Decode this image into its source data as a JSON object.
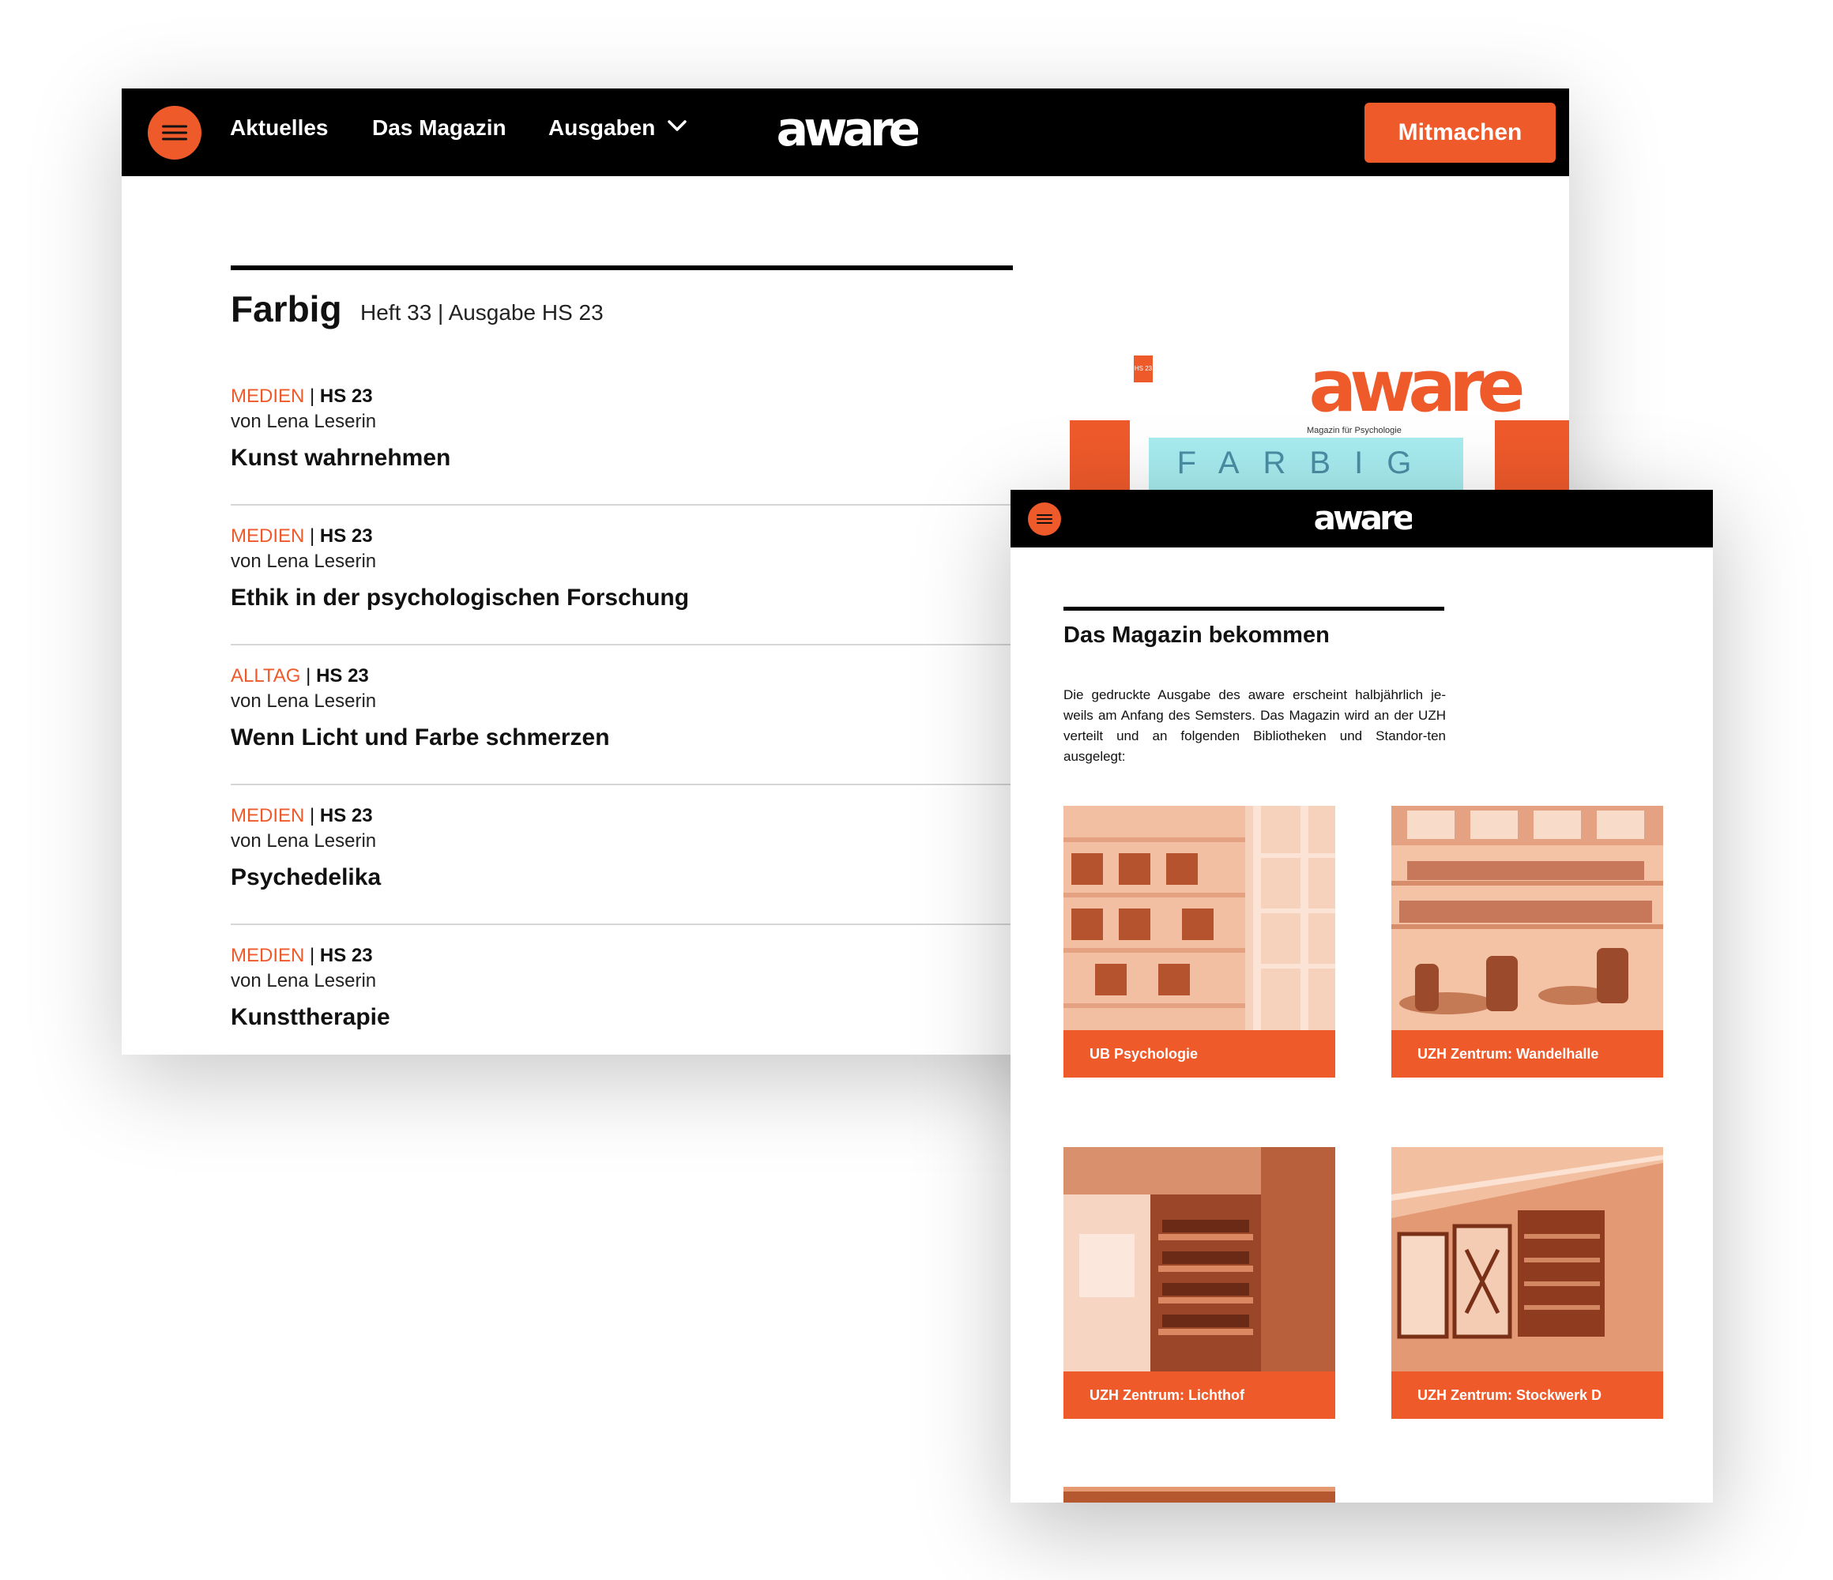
{
  "desktop": {
    "menu_icon": "hamburger-icon",
    "nav": {
      "aktuelles": "Aktuelles",
      "magazin": "Das Magazin",
      "ausgaben": "Ausgaben",
      "ausgaben_icon": "chevron-down-icon"
    },
    "logo": "aware",
    "cta": "Mitmachen",
    "issue": {
      "title": "Farbig",
      "subtitle": "Heft 33 | Ausgabe HS 23"
    },
    "articles": [
      {
        "category": "MEDIEN",
        "separator": "|",
        "semester": "HS 23",
        "author": "von Lena Leserin",
        "title": "Kunst wahrnehmen"
      },
      {
        "category": "MEDIEN",
        "separator": "|",
        "semester": "HS 23",
        "author": "von Lena Leserin",
        "title": "Ethik in der psychologischen Forschung"
      },
      {
        "category": "ALLTAG",
        "separator": "|",
        "semester": "HS 23",
        "author": "von Lena Leserin",
        "title": "Wenn Licht und Farbe schmerzen"
      },
      {
        "category": "MEDIEN",
        "separator": "|",
        "semester": "HS 23",
        "author": "von Lena Leserin",
        "title": "Psychedelika"
      },
      {
        "category": "MEDIEN",
        "separator": "|",
        "semester": "HS 23",
        "author": "von Lena Leserin",
        "title": "Kunsttherapie"
      }
    ],
    "cover": {
      "tag": "HS 23",
      "logo": "aware",
      "tagline": "Magazin für Psychologie",
      "word": "FARBIG"
    }
  },
  "mobile": {
    "menu_icon": "hamburger-icon",
    "logo": "aware",
    "section_title": "Das Magazin bekommen",
    "intro": "Die gedruckte Ausgabe des aware erscheint halbjährlich je-weils am Anfang des Semsters. Das Magazin wird an der UZH verteilt und an folgenden Bibliotheken und Standor-ten ausgelegt:",
    "locations": [
      {
        "label": "UB Psychologie"
      },
      {
        "label": "UZH Zentrum: Wandelhalle"
      },
      {
        "label": "UZH Zentrum: Lichthof"
      },
      {
        "label": "UZH Zentrum: Stockwerk D"
      }
    ]
  },
  "colors": {
    "accent": "#ef5a2b",
    "header": "#000000",
    "divider": "#d6d6d6"
  }
}
